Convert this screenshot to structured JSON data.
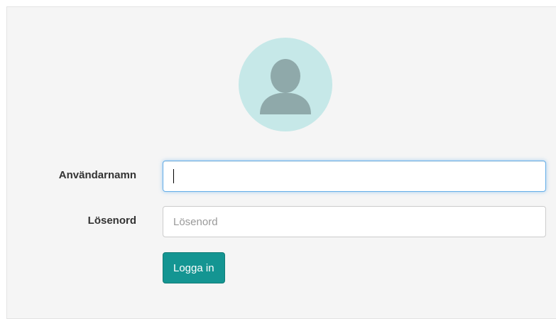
{
  "login": {
    "avatar_icon": "user-silhouette-icon",
    "username_label": "Användarnamn",
    "username_value": "",
    "password_label": "Lösenord",
    "password_placeholder": "Lösenord",
    "password_value": "",
    "submit_label": "Logga in"
  },
  "colors": {
    "panel_bg": "#f5f5f5",
    "avatar_bg": "#c6e8e8",
    "avatar_silhouette": "#8fa9aa",
    "button_bg": "#149592",
    "focus_border": "#66afe9"
  }
}
